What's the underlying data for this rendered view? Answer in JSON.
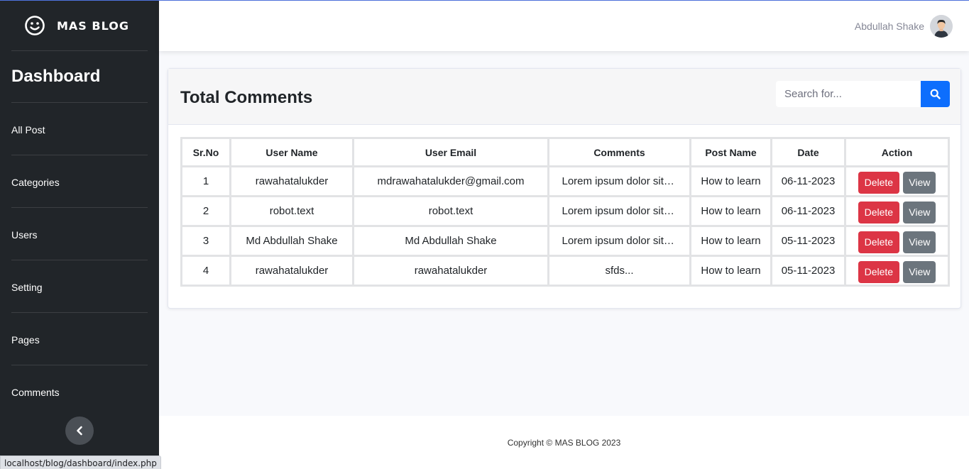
{
  "sidebar": {
    "brand_name": "MAS BLOG",
    "dashboard_title": "Dashboard",
    "items": [
      {
        "label": "All Post"
      },
      {
        "label": "Categories"
      },
      {
        "label": "Users"
      },
      {
        "label": "Setting"
      },
      {
        "label": "Pages"
      },
      {
        "label": "Comments"
      }
    ],
    "toggle_icon": "chevron-left-icon"
  },
  "status_bar": {
    "url": "localhost/blog/dashboard/index.php"
  },
  "topbar": {
    "user_name": "Abdullah Shake"
  },
  "main": {
    "title": "Total Comments",
    "search": {
      "placeholder": "Search for..."
    },
    "table": {
      "headers": [
        "Sr.No",
        "User Name",
        "User Email",
        "Comments",
        "Post Name",
        "Date",
        "Action"
      ],
      "rows": [
        {
          "sr": "1",
          "user_name": "rawahatalukder",
          "user_email": "mdrawahatalukder@gmail.com",
          "comment": "Lorem ipsum dolor sit amet",
          "post": "How to learn",
          "date": "06-11-2023"
        },
        {
          "sr": "2",
          "user_name": "robot.text",
          "user_email": "robot.text",
          "comment": "Lorem ipsum dolor sit amet",
          "post": "How to learn",
          "date": "06-11-2023"
        },
        {
          "sr": "3",
          "user_name": "Md Abdullah Shake",
          "user_email": "Md Abdullah Shake",
          "comment": "Lorem ipsum dolor sit amet",
          "post": "How to learn",
          "date": "05-11-2023"
        },
        {
          "sr": "4",
          "user_name": "rawahatalukder",
          "user_email": "rawahatalukder",
          "comment": "sfds...",
          "post": "How to learn",
          "date": "05-11-2023"
        }
      ],
      "delete_label": "Delete",
      "view_label": "View"
    }
  },
  "footer": {
    "copyright": "Copyright © MAS BLOG 2023"
  },
  "colors": {
    "sidebar_bg": "#212529",
    "primary": "#0d6efd",
    "danger": "#dc3545",
    "secondary": "#6c757d"
  }
}
